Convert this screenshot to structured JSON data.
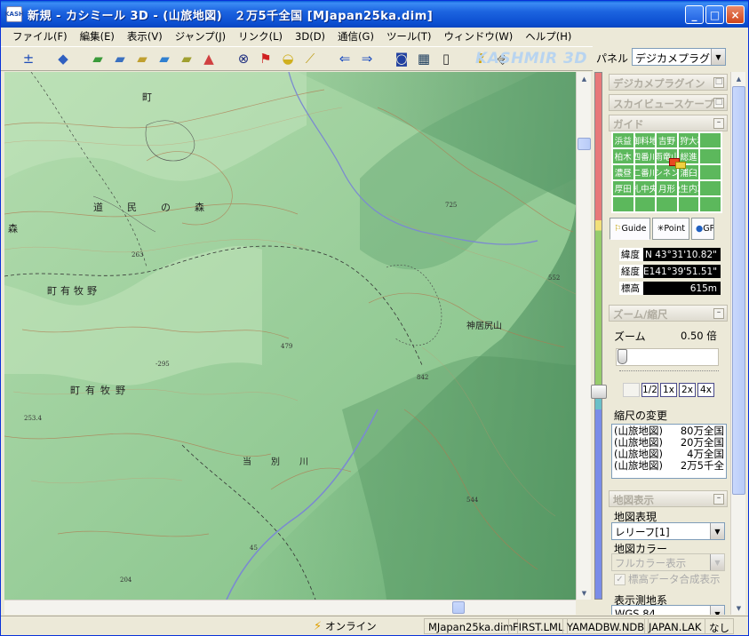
{
  "window": {
    "title": "新規 - カシミール 3D - (山旅地図)　２万5千全国 [MJapan25ka.dim]",
    "icon_text": "KASH",
    "buttons": {
      "minimize": "_",
      "maximize": "□",
      "close": "×"
    }
  },
  "menu": [
    "ファイル(F)",
    "編集(E)",
    "表示(V)",
    "ジャンプ(J)",
    "リンク(L)",
    "3D(D)",
    "通信(G)",
    "ツール(T)",
    "ウィンドウ(W)",
    "ヘルプ(H)"
  ],
  "toolbar": {
    "logo": "KASHMIR 3D",
    "icons": [
      "zoom-search-icon",
      "layer-icon",
      "map-green-icon",
      "map-relief-icon",
      "map-yellow-icon",
      "map-blue-icon",
      "map-tile-icon",
      "map-red-icon",
      "binoculars-icon",
      "flags-icon",
      "cheese-icon",
      "ruler-icon",
      "arrow-left-icon",
      "arrow-right-icon",
      "camera-icon",
      "film-icon",
      "gps-icon",
      "help-icon",
      "exit-icon"
    ]
  },
  "panel": {
    "label": "パネル",
    "selected": "デジカメプラグイン"
  },
  "map_labels": {
    "l1": "町",
    "l2": "道　民　の　森",
    "l3": "森",
    "l4": "町有牧野",
    "l5": "町有牧野",
    "l6": "神居尻山",
    "l7": "当　別　川",
    "h1": "479",
    "h2": "263",
    "h3": "-295",
    "h4": "253.4",
    "h5": "725",
    "h6": "842",
    "h7": "544",
    "h8": "45",
    "h9": "204",
    "h10": "552"
  },
  "sections": {
    "digicam": "デジカメプラグイン",
    "skyview": "スカイビュースケープ",
    "guide": "ガイド",
    "zoom": "ズーム/縮尺",
    "mapview": "地図表示"
  },
  "guide_grid": [
    "浜益",
    "御料地",
    "吉野",
    "5 狩大和",
    "",
    "柏木",
    "四番川",
    "雨竜山",
    "総進",
    "",
    "濃昼",
    "二番川",
    "シネン",
    "浦臼",
    "",
    "厚田",
    "札中央",
    "月形",
    "晩生内次",
    "",
    "",
    "",
    "",
    "",
    ""
  ],
  "tabs": [
    {
      "label": "Guide"
    },
    {
      "label": "Point"
    },
    {
      "label": "GPS"
    }
  ],
  "coords": {
    "lat_label": "緯度",
    "lat": "N 43°31'10.82\"",
    "lon_label": "経度",
    "lon": "E141°39'51.51\"",
    "alt_label": "標高",
    "alt": "615m"
  },
  "zoom": {
    "label": "ズーム",
    "value": "0.50 倍",
    "buttons": [
      "",
      "1/2",
      "1x",
      "2x",
      "4x"
    ]
  },
  "scale": {
    "title": "縮尺の変更",
    "items": [
      {
        "name": "(山旅地図)",
        "scale": "80万全国"
      },
      {
        "name": "(山旅地図)",
        "scale": "20万全国"
      },
      {
        "name": "(山旅地図)",
        "scale": "4万全国"
      },
      {
        "name": "(山旅地図)",
        "scale": "2万5千全"
      }
    ]
  },
  "mapview": {
    "expression_label": "地図表現",
    "expression": "レリーフ[1]",
    "color_label": "地図カラー",
    "color": "フルカラー表示",
    "elev_check": "標高データ合成表示",
    "datum_label": "表示測地系",
    "datum": "WGS 84"
  },
  "status": {
    "online": "オンライン",
    "fields": [
      "MJapan25ka.dim",
      "FIRST.LML",
      "YAMADBW.NDB",
      "JAPAN.LAK",
      "なし"
    ]
  }
}
